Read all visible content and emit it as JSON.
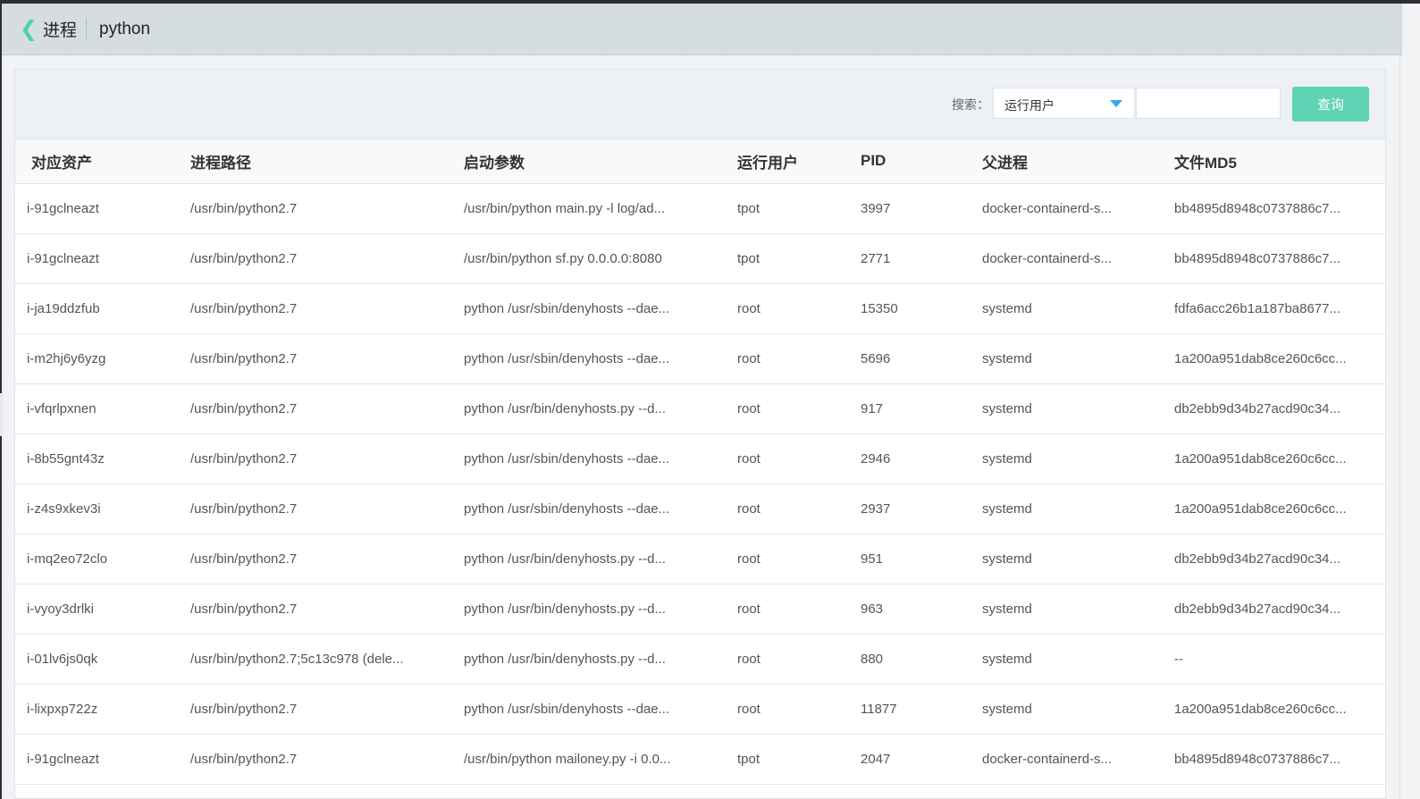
{
  "header": {
    "back_icon": "chevron-left-icon",
    "title": "进程",
    "subtitle": "python"
  },
  "search": {
    "label": "搜索：",
    "field_selected": "运行用户",
    "input_value": "",
    "button": "查询"
  },
  "colors": {
    "accent": "#5fd3b3",
    "caret": "#3aa9f2"
  },
  "table": {
    "columns": [
      "对应资产",
      "进程路径",
      "启动参数",
      "运行用户",
      "PID",
      "父进程",
      "文件MD5"
    ],
    "rows": [
      [
        "i-91gclneazt",
        "/usr/bin/python2.7",
        "/usr/bin/python main.py -l log/ad...",
        "tpot",
        "3997",
        "docker-containerd-s...",
        "bb4895d8948c0737886c7..."
      ],
      [
        "i-91gclneazt",
        "/usr/bin/python2.7",
        "/usr/bin/python sf.py 0.0.0.0:8080",
        "tpot",
        "2771",
        "docker-containerd-s...",
        "bb4895d8948c0737886c7..."
      ],
      [
        "i-ja19ddzfub",
        "/usr/bin/python2.7",
        "python /usr/sbin/denyhosts --dae...",
        "root",
        "15350",
        "systemd",
        "fdfa6acc26b1a187ba8677..."
      ],
      [
        "i-m2hj6y6yzg",
        "/usr/bin/python2.7",
        "python /usr/sbin/denyhosts --dae...",
        "root",
        "5696",
        "systemd",
        "1a200a951dab8ce260c6cc..."
      ],
      [
        "i-vfqrlpxnen",
        "/usr/bin/python2.7",
        "python /usr/bin/denyhosts.py --d...",
        "root",
        "917",
        "systemd",
        "db2ebb9d34b27acd90c34..."
      ],
      [
        "i-8b55gnt43z",
        "/usr/bin/python2.7",
        "python /usr/sbin/denyhosts --dae...",
        "root",
        "2946",
        "systemd",
        "1a200a951dab8ce260c6cc..."
      ],
      [
        "i-z4s9xkev3i",
        "/usr/bin/python2.7",
        "python /usr/sbin/denyhosts --dae...",
        "root",
        "2937",
        "systemd",
        "1a200a951dab8ce260c6cc..."
      ],
      [
        "i-mq2eo72clo",
        "/usr/bin/python2.7",
        "python /usr/bin/denyhosts.py --d...",
        "root",
        "951",
        "systemd",
        "db2ebb9d34b27acd90c34..."
      ],
      [
        "i-vyoy3drlki",
        "/usr/bin/python2.7",
        "python /usr/bin/denyhosts.py --d...",
        "root",
        "963",
        "systemd",
        "db2ebb9d34b27acd90c34..."
      ],
      [
        "i-01lv6js0qk",
        "/usr/bin/python2.7;5c13c978 (dele...",
        "python /usr/bin/denyhosts.py --d...",
        "root",
        "880",
        "systemd",
        "--"
      ],
      [
        "i-lixpxp722z",
        "/usr/bin/python2.7",
        "python /usr/sbin/denyhosts --dae...",
        "root",
        "11877",
        "systemd",
        "1a200a951dab8ce260c6cc..."
      ],
      [
        "i-91gclneazt",
        "/usr/bin/python2.7",
        "/usr/bin/python mailoney.py -i 0.0...",
        "tpot",
        "2047",
        "docker-containerd-s...",
        "bb4895d8948c0737886c7..."
      ]
    ]
  }
}
